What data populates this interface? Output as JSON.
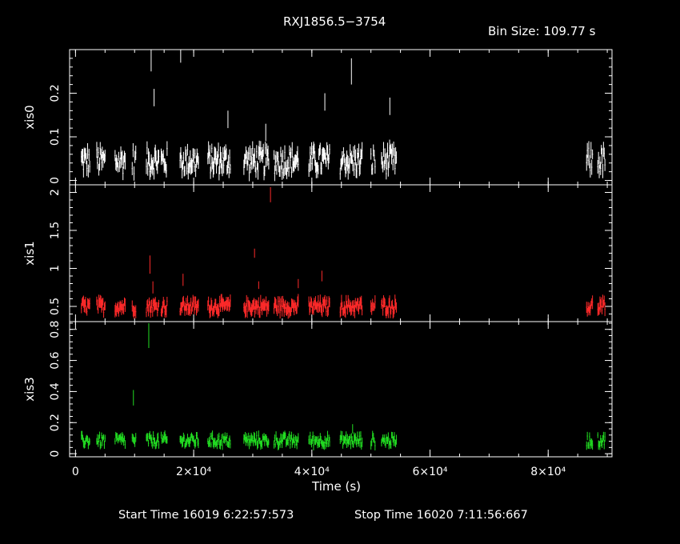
{
  "title": "RXJ1856.5−3754",
  "bin_size": "Bin Size: 109.77 s",
  "xlabel": "Time (s)",
  "start_time": "Start Time 16019  6:22:57:573",
  "stop_time": "Stop Time 16020  7:11:56:667",
  "colors": {
    "xis0": "#ffffff",
    "xis1": "#ff2a2a",
    "xis3": "#22dd22",
    "axes": "#ffffff",
    "background": "#000000"
  },
  "chart_data": {
    "type": "scatter",
    "x_range": [
      -1000,
      90800
    ],
    "x_ticks": [
      0,
      20000,
      40000,
      60000,
      80000
    ],
    "x_tick_labels": [
      "0",
      "2×10⁴",
      "4×10⁴",
      "6×10⁴",
      "8×10⁴"
    ],
    "panels": [
      {
        "name": "xis0",
        "ylabel": "xis0",
        "ylim": [
          -0.01,
          0.3
        ],
        "y_ticks": [
          0,
          0.1,
          0.2
        ],
        "y_tick_labels": [
          "0",
          "0.1",
          "0.2"
        ],
        "color": "#ffffff",
        "base": 0.045,
        "amp": 0.03,
        "err": 0.015,
        "spikes": [
          {
            "x": 12800,
            "y": 0.28,
            "err": 0.03
          },
          {
            "x": 13300,
            "y": 0.19,
            "err": 0.02
          },
          {
            "x": 17800,
            "y": 0.29,
            "err": 0.02
          },
          {
            "x": 25800,
            "y": 0.14,
            "err": 0.02
          },
          {
            "x": 32200,
            "y": 0.11,
            "err": 0.02
          },
          {
            "x": 42200,
            "y": 0.18,
            "err": 0.02
          },
          {
            "x": 46700,
            "y": 0.25,
            "err": 0.03
          },
          {
            "x": 53200,
            "y": 0.17,
            "err": 0.02
          }
        ]
      },
      {
        "name": "xis1",
        "ylabel": "xis1",
        "ylim": [
          0.3,
          2.1
        ],
        "y_ticks": [
          0.5,
          1,
          1.5,
          2
        ],
        "y_tick_labels": [
          "0.5",
          "1",
          "1.5",
          "2"
        ],
        "color": "#ff2a2a",
        "base": 0.5,
        "amp": 0.08,
        "err": 0.07,
        "spikes": [
          {
            "x": 12600,
            "y": 1.05,
            "err": 0.12
          },
          {
            "x": 13100,
            "y": 0.75,
            "err": 0.08
          },
          {
            "x": 18200,
            "y": 0.85,
            "err": 0.08
          },
          {
            "x": 30300,
            "y": 1.2,
            "err": 0.06
          },
          {
            "x": 31000,
            "y": 0.78,
            "err": 0.05
          },
          {
            "x": 33000,
            "y": 1.97,
            "err": 0.1
          },
          {
            "x": 37700,
            "y": 0.8,
            "err": 0.06
          },
          {
            "x": 41700,
            "y": 0.9,
            "err": 0.07
          }
        ]
      },
      {
        "name": "xis3",
        "ylabel": "xis3",
        "ylim": [
          -0.02,
          0.85
        ],
        "y_ticks": [
          0,
          0.2,
          0.4,
          0.6,
          0.8
        ],
        "y_tick_labels": [
          "0",
          "0.2",
          "0.4",
          "0.6",
          "0.8"
        ],
        "color": "#22dd22",
        "base": 0.085,
        "amp": 0.035,
        "err": 0.025,
        "spikes": [
          {
            "x": 12400,
            "y": 0.76,
            "err": 0.08
          },
          {
            "x": 9800,
            "y": 0.36,
            "err": 0.05
          },
          {
            "x": 46900,
            "y": 0.16,
            "err": 0.03
          }
        ]
      }
    ],
    "segments": [
      [
        1000,
        2400
      ],
      [
        3600,
        5000
      ],
      [
        6700,
        8400
      ],
      [
        9600,
        10200
      ],
      [
        12000,
        14100
      ],
      [
        14500,
        15500
      ],
      [
        17700,
        20800
      ],
      [
        22400,
        26200
      ],
      [
        28500,
        32700
      ],
      [
        33600,
        37700
      ],
      [
        39500,
        43000
      ],
      [
        44800,
        48500
      ],
      [
        50000,
        50700
      ],
      [
        51800,
        54300
      ],
      [
        86500,
        87500
      ],
      [
        88400,
        89600
      ]
    ]
  }
}
